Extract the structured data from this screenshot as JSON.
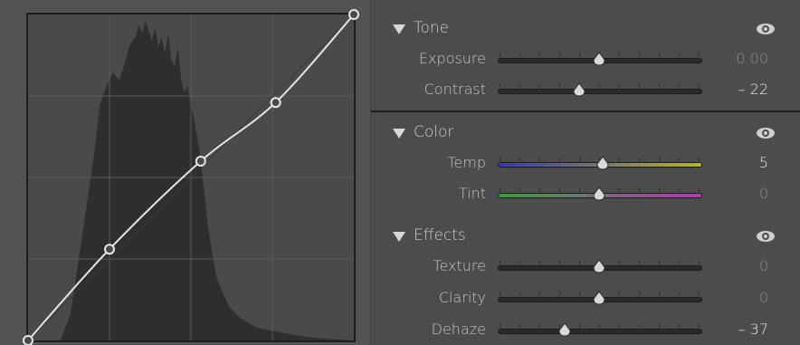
{
  "curve": {
    "points": [
      [
        0.0,
        0.0
      ],
      [
        0.25,
        0.28
      ],
      [
        0.53,
        0.55
      ],
      [
        0.76,
        0.73
      ],
      [
        1.0,
        1.0
      ]
    ]
  },
  "sections": [
    {
      "title": "Tone",
      "rows": [
        {
          "label": "Exposure",
          "value": "0.00",
          "position": 0.5,
          "track": "neutral",
          "active": false
        },
        {
          "label": "Contrast",
          "value": "– 22",
          "position": 0.4,
          "track": "neutral",
          "active": true
        }
      ]
    },
    {
      "title": "Color",
      "rows": [
        {
          "label": "Temp",
          "value": "5",
          "position": 0.52,
          "track": "temp",
          "active": true
        },
        {
          "label": "Tint",
          "value": "0",
          "position": 0.5,
          "track": "tint",
          "active": false
        }
      ]
    },
    {
      "title": "Effects",
      "rows": [
        {
          "label": "Texture",
          "value": "0",
          "position": 0.5,
          "track": "neutral",
          "active": false
        },
        {
          "label": "Clarity",
          "value": "0",
          "position": 0.5,
          "track": "neutral",
          "active": false
        },
        {
          "label": "Dehaze",
          "value": "– 37",
          "position": 0.33,
          "track": "neutral",
          "active": true
        }
      ]
    }
  ],
  "colors": {
    "temp_gradient": [
      "#3a3aa8",
      "#b7b23a"
    ],
    "tint_gradient": [
      "#3c9a3c",
      "#b23cb2"
    ]
  }
}
